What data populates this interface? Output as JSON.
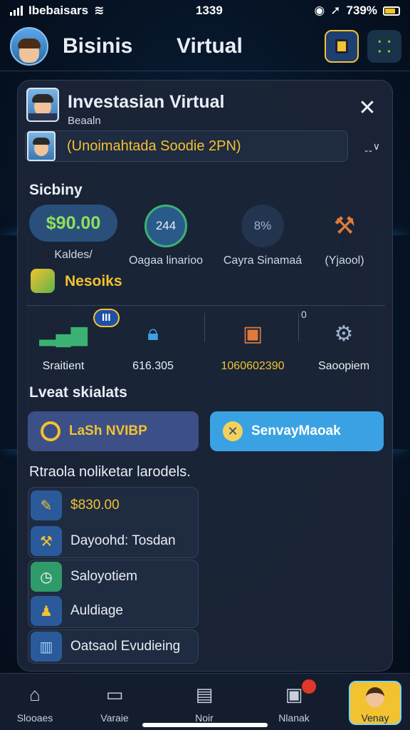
{
  "status_bar": {
    "carrier": "Ibebaisars",
    "time": "1339",
    "battery": "739%"
  },
  "header": {
    "title_left": "Bisinis",
    "title_right": "Virtual",
    "accent_color": "#f2c230"
  },
  "panel": {
    "title": "Investasian Virtual",
    "subtitle": "Beaaln",
    "close_glyph": "✕",
    "selector_value": "(Unoimahtada Soodie 2PN)",
    "selector_arrow": "ˬˬ∨"
  },
  "stats": {
    "section_title": "Sicbiny",
    "items": [
      {
        "value": "$90.00",
        "label": "Kaldes/"
      },
      {
        "value": "244",
        "label": "Oagaa linarioo"
      },
      {
        "value": "8%",
        "label": "Cayra Sinamaá"
      },
      {
        "value": "",
        "label": "(Yjaool)"
      }
    ]
  },
  "resources": {
    "section_title": "Nesoiks",
    "badge": "III",
    "zero": "0",
    "tools": [
      {
        "label": "Sraitient"
      },
      {
        "label": "616.305"
      },
      {
        "label": "1060602390"
      },
      {
        "label": "Saoopiem"
      }
    ]
  },
  "actions": {
    "section_title": "Lveat skialats",
    "search_label": "LaSh NVIBP",
    "survey_label": "SenvayMaoak"
  },
  "list": {
    "section_title": "Rtraola noliketar larodels.",
    "items": [
      {
        "text": "$830.00",
        "highlight": true
      },
      {
        "text": "Dayoohd: Tosdan",
        "highlight": false
      },
      {
        "text": "Saloyotiem",
        "highlight": false
      },
      {
        "text": "Auldiage",
        "highlight": false
      },
      {
        "text": "Oatsaol Evudieing",
        "highlight": false
      }
    ]
  },
  "bottom_nav": {
    "items": [
      {
        "label": "Slooaes",
        "icon": "house-icon"
      },
      {
        "label": "Varaie",
        "icon": "monitor-icon"
      },
      {
        "label": "Noir",
        "icon": "clipboard-icon"
      },
      {
        "label": "Nlanak",
        "icon": "wallet-icon"
      },
      {
        "label": "Venay",
        "icon": "avatar-icon"
      }
    ]
  }
}
